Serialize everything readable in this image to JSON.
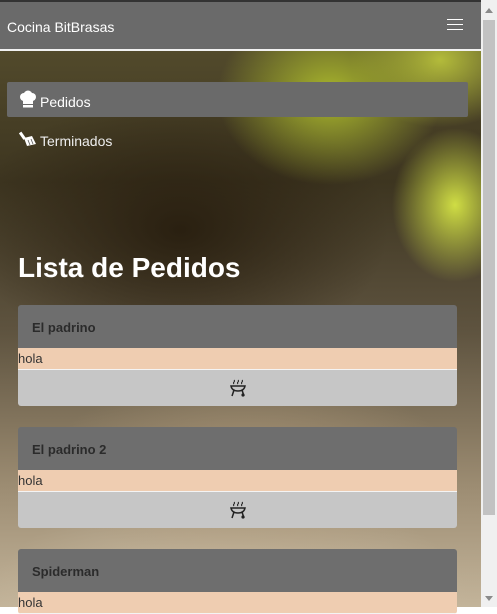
{
  "navbar": {
    "brand": "Cocina BitBrasas",
    "menu_icon": "hamburger-icon"
  },
  "menu": {
    "items": [
      {
        "label": "Pedidos",
        "icon": "chef-hat-icon",
        "active": true
      },
      {
        "label": "Terminados",
        "icon": "broom-icon",
        "active": false
      }
    ]
  },
  "page": {
    "title": "Lista de Pedidos"
  },
  "orders": [
    {
      "name": "El padrino",
      "note": "hola",
      "action_icon": "grill-icon"
    },
    {
      "name": "El padrino 2",
      "note": "hola",
      "action_icon": "grill-icon"
    },
    {
      "name": "Spiderman",
      "note": "hola",
      "action_icon": "grill-icon"
    }
  ],
  "colors": {
    "navbar": "#6a6a6a",
    "card_header": "#6e6e6e",
    "card_body": "#efcdb1",
    "card_footer": "#c6c6c6"
  }
}
